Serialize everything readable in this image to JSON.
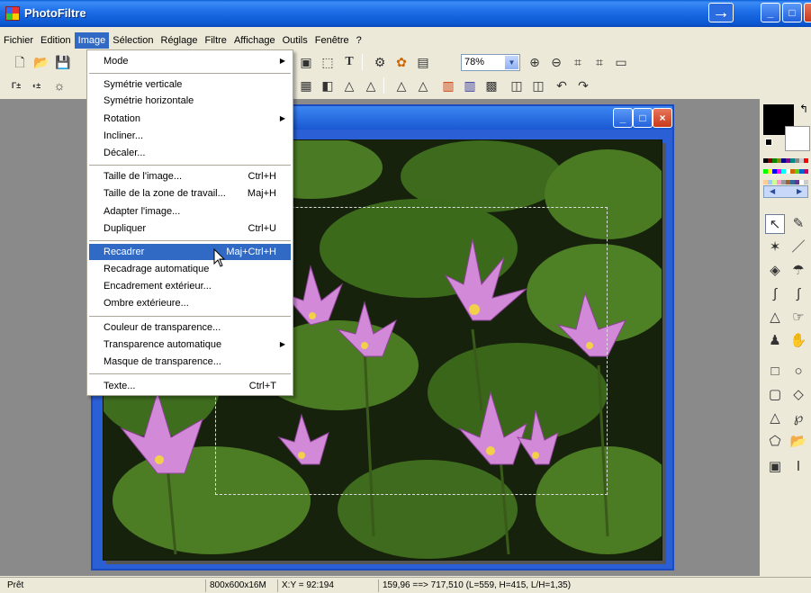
{
  "title": "PhotoFiltre",
  "menubar": [
    "Fichier",
    "Edition",
    "Image",
    "Sélection",
    "Réglage",
    "Filtre",
    "Affichage",
    "Outils",
    "Fenêtre",
    "?"
  ],
  "zoom": "78%",
  "image_menu": {
    "mode": "Mode",
    "flipv": "Symétrie verticale",
    "fliph": "Symétrie horizontale",
    "rotation": "Rotation",
    "skew": "Incliner...",
    "offset": "Décaler...",
    "imgsize": "Taille de l'image...",
    "imgsize_sc": "Ctrl+H",
    "canvas": "Taille de la zone de travail...",
    "canvas_sc": "Maj+H",
    "adapt": "Adapter l'image...",
    "dup": "Dupliquer",
    "dup_sc": "Ctrl+U",
    "crop": "Recadrer",
    "crop_sc": "Maj+Ctrl+H",
    "autocrop": "Recadrage automatique",
    "frame": "Encadrement extérieur...",
    "shadow": "Ombre extérieure...",
    "transp_color": "Couleur de transparence...",
    "auto_transp": "Transparence automatique",
    "transp_mask": "Masque de transparence...",
    "text": "Texte...",
    "text_sc": "Ctrl+T"
  },
  "status": {
    "ready": "Prêt",
    "imginfo": "800x600x16M",
    "coords": "X:Y = 92:194",
    "selinfo": "159,96 ==> 717,510 (L=559, H=415, L/H=1,35)"
  },
  "colors": {
    "accent": "#316ac5",
    "titlebar": "#0a57d0",
    "foreground": "#000000",
    "background": "#ffffff"
  }
}
